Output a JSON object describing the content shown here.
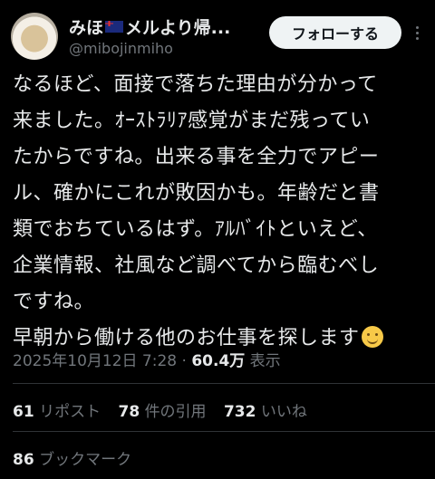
{
  "author": {
    "name_part1": "みほ",
    "name_part2": "メルより帰...",
    "handle": "@mibojinmiho"
  },
  "follow_label": "フォローする",
  "tweet": {
    "text": "なるほど、面接で落ちた理由が分かって\n来ました。ｵｰｽﾄﾗﾘｱ感覚がまだ残ってい\nたからですね。出来る事を全力でアピー\nル、確かにこれが敗因かも。年齢だと書\n類でおちているはず。ｱﾙﾊﾞｲﾄといえど、\n企業情報、社風など調べてから臨むべし\nですね。\n早朝から働ける他のお仕事を探します",
    "emoji": "smiling-face-emoji"
  },
  "meta": {
    "timestamp": "2025年10月12日 7:28",
    "separator": " · ",
    "views_count": "60.4万",
    "views_label": " 表示"
  },
  "stats": {
    "reposts_count": "61",
    "reposts_label": "リポスト",
    "quotes_count": "78",
    "quotes_label": "件の引用",
    "likes_count": "732",
    "likes_label": "いいね",
    "bookmarks_count": "86",
    "bookmarks_label": "ブックマーク"
  },
  "colors": {
    "background": "#000000",
    "text": "#e7e9ea",
    "secondary_text": "#71767b",
    "button_bg": "#eff3f4"
  }
}
